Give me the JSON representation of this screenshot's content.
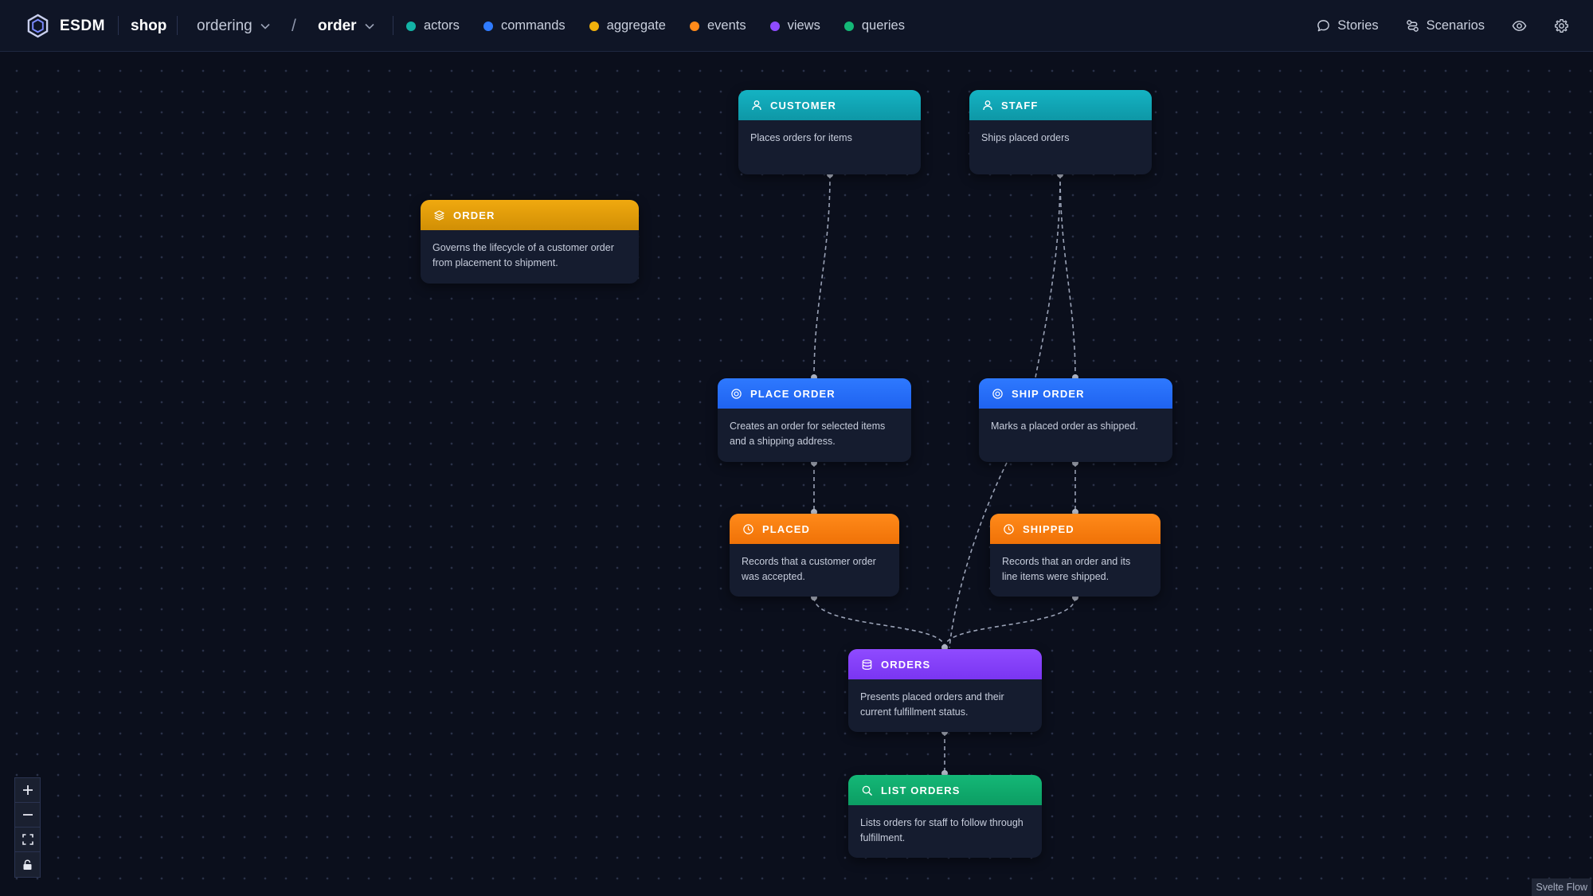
{
  "app": {
    "brand": "ESDM",
    "project": "shop",
    "context": "ordering",
    "separator": "/",
    "aggregate": "order"
  },
  "legend": [
    {
      "label": "actors",
      "color": "#13b3a6"
    },
    {
      "label": "commands",
      "color": "#2f7bff"
    },
    {
      "label": "aggregate",
      "color": "#f0b10c"
    },
    {
      "label": "events",
      "color": "#ff8a1a"
    },
    {
      "label": "views",
      "color": "#8f4bff"
    },
    {
      "label": "queries",
      "color": "#14b877"
    }
  ],
  "actions": {
    "stories": "Stories",
    "scenarios": "Scenarios",
    "eye_icon": "eye-icon",
    "settings_icon": "gear-icon"
  },
  "nodes": {
    "customer": {
      "kind": "actor",
      "title": "CUSTOMER",
      "desc": "Places orders for items"
    },
    "staff": {
      "kind": "actor",
      "title": "STAFF",
      "desc": "Ships placed orders"
    },
    "order": {
      "kind": "aggregate",
      "title": "ORDER",
      "desc": "Governs the lifecycle of a customer order from placement to shipment."
    },
    "place_order": {
      "kind": "command",
      "title": "PLACE ORDER",
      "desc": "Creates an order for selected items and a shipping address."
    },
    "ship_order": {
      "kind": "command",
      "title": "SHIP ORDER",
      "desc": "Marks a placed order as shipped."
    },
    "placed": {
      "kind": "event",
      "title": "PLACED",
      "desc": "Records that a customer order was accepted."
    },
    "shipped": {
      "kind": "event",
      "title": "SHIPPED",
      "desc": "Records that an order and its line items were shipped."
    },
    "orders": {
      "kind": "view",
      "title": "ORDERS",
      "desc": "Presents placed orders and their current fulfillment status."
    },
    "list_orders": {
      "kind": "query",
      "title": "LIST ORDERS",
      "desc": "Lists orders for staff to follow through fulfillment."
    }
  },
  "controls": [
    "zoom-in",
    "zoom-out",
    "fit-view",
    "lock"
  ],
  "attribution": "Svelte Flow"
}
